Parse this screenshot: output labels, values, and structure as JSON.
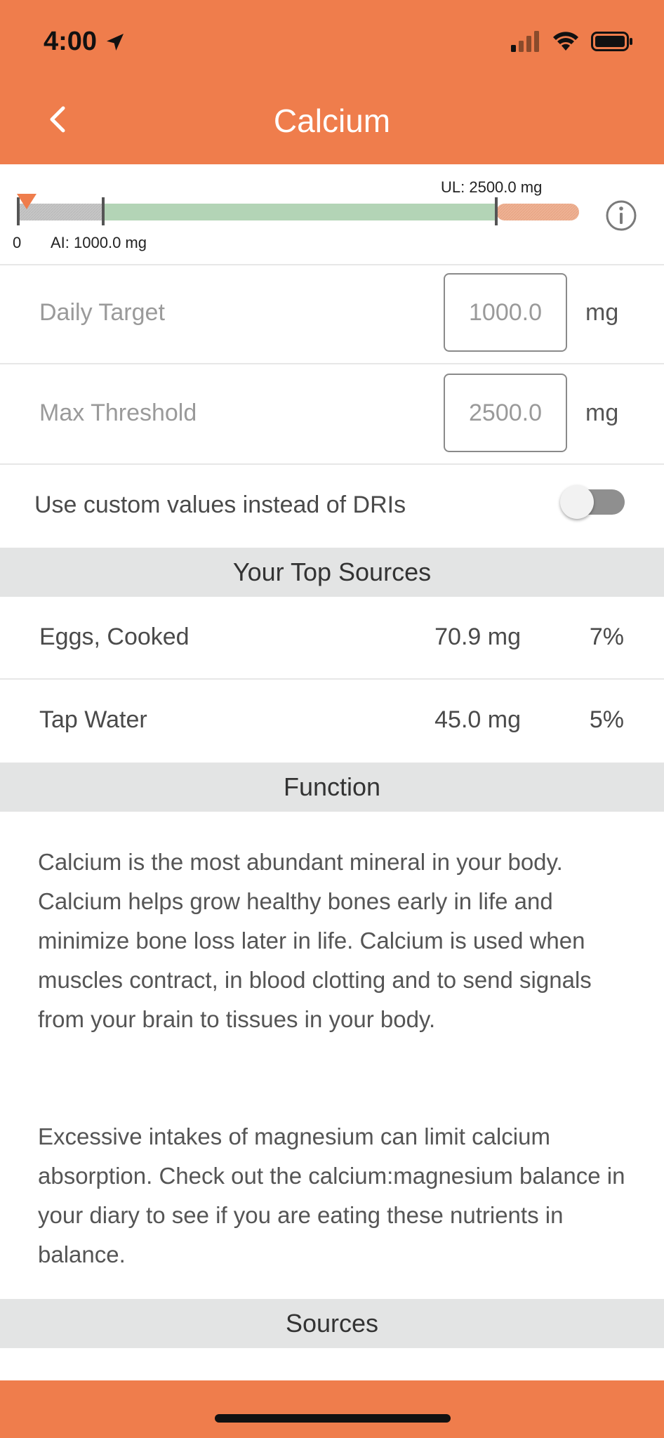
{
  "status_bar": {
    "time": "4:00"
  },
  "header": {
    "title": "Calcium"
  },
  "gauge": {
    "zero_label": "0",
    "ai_label": "AI: 1000.0 mg",
    "ul_label": "UL: 2500.0 mg",
    "current_value_mg": 0,
    "ai_value_mg": 1000.0,
    "ul_value_mg": 2500.0,
    "colors": {
      "below": "#c6c6c6",
      "adequate": "#b3d4b6",
      "above": "#eeb294",
      "marker": "#ef7d4c"
    }
  },
  "daily_target": {
    "label": "Daily Target",
    "value": "1000.0",
    "unit": "mg"
  },
  "max_threshold": {
    "label": "Max Threshold",
    "value": "2500.0",
    "unit": "mg"
  },
  "custom_values": {
    "label": "Use custom values instead of DRIs",
    "enabled": false
  },
  "top_sources": {
    "heading": "Your Top Sources",
    "items": [
      {
        "name": "Eggs, Cooked",
        "amount": "70.9 mg",
        "percent": "7%"
      },
      {
        "name": "Tap Water",
        "amount": "45.0 mg",
        "percent": "5%"
      }
    ]
  },
  "function": {
    "heading": "Function",
    "paragraphs": [
      "Calcium is the most abundant mineral in your body. Calcium helps grow healthy bones early in life and minimize bone loss later in life. Calcium is used when muscles contract, in blood clotting and to send signals from your brain to tissues in your body.",
      "Excessive intakes of magnesium can limit calcium absorption. Check out the calcium:magnesium balance in your diary to see if you are eating these nutrients in balance."
    ]
  },
  "sources": {
    "heading": "Sources"
  },
  "colors": {
    "accent": "#ef7d4c",
    "section_bg": "#e3e4e4"
  }
}
